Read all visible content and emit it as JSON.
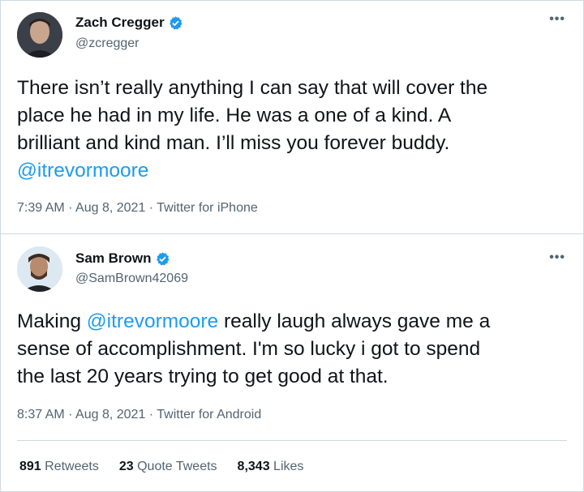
{
  "tweets": [
    {
      "name": "Zach Cregger",
      "handle": "@zcregger",
      "text_lines": [
        "There isn’t really anything I can say that will cover the",
        "place he had in my life.  He was a one of a kind. A",
        "brilliant and kind man. I’ll miss you forever buddy."
      ],
      "mention": "@itrevormoore",
      "meta": "7:39 AM · Aug 8, 2021 · Twitter for iPhone"
    },
    {
      "name": "Sam Brown",
      "handle": "@SamBrown42069",
      "text_pre": "Making ",
      "mention": "@itrevormoore",
      "text_post": " really laugh always gave me a",
      "text_lines": [
        "sense of accomplishment.  I'm so lucky i got to spend",
        "the last 20 years trying to get good at that."
      ],
      "meta": "8:37 AM · Aug 8, 2021 · Twitter for Android",
      "stats": {
        "retweets_count": "891",
        "retweets_label": "Retweets",
        "quotes_count": "23",
        "quotes_label": "Quote Tweets",
        "likes_count": "8,343",
        "likes_label": "Likes"
      }
    }
  ],
  "icons": {
    "more": "more-icon",
    "verified": "verified-badge-icon"
  },
  "colors": {
    "link": "#1d9bf0",
    "muted": "#536471",
    "verified": "#1d9bf0"
  }
}
